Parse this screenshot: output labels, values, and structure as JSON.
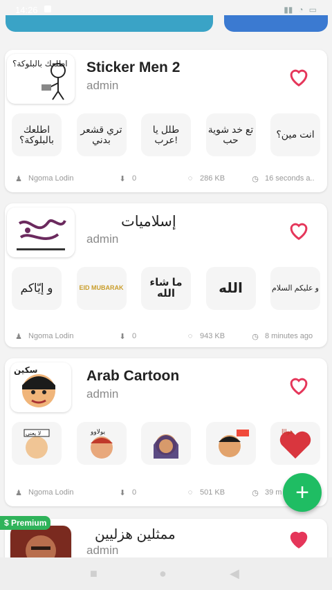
{
  "status_bar": {
    "time": "14:26"
  },
  "packs": [
    {
      "title": "Sticker Men 2",
      "author": "admin",
      "thumb_label": "اطلعك بالبلوكة؟",
      "stickers": [
        "اطلعك بالبلوكة؟",
        "تري قشعر بدني",
        "طلل يا عرب!",
        "تع خد شوية حب",
        "انت مين؟"
      ],
      "meta": {
        "uploader": "Ngoma Lodin",
        "downloads": "0",
        "size": "286 KB",
        "time": "16 seconds a.."
      },
      "favorited": false
    },
    {
      "title": "إسلاميات",
      "author": "admin",
      "thumb_label": "",
      "stickers": [
        "و إيّاكم",
        "EID MUBARAK",
        "ما شاء الله",
        "الله",
        "و عليكم السلام"
      ],
      "meta": {
        "uploader": "Ngoma Lodin",
        "downloads": "0",
        "size": "943 KB",
        "time": "8 minutes ago"
      },
      "favorited": false
    },
    {
      "title": "Arab Cartoon",
      "author": "admin",
      "thumb_label": "",
      "stickers": [
        "لا يعني",
        "يولاوو",
        "",
        "",
        "هوااا"
      ],
      "meta": {
        "uploader": "Ngoma Lodin",
        "downloads": "0",
        "size": "501 KB",
        "time": "39 m"
      },
      "favorited": false
    },
    {
      "title": "ممثلين هزليين",
      "author": "admin",
      "favorited": true
    }
  ],
  "premium_badge": "$ Premium",
  "fab_label": "+",
  "colors": {
    "accent_green": "#1fbd63",
    "heart_red": "#e5365a"
  }
}
